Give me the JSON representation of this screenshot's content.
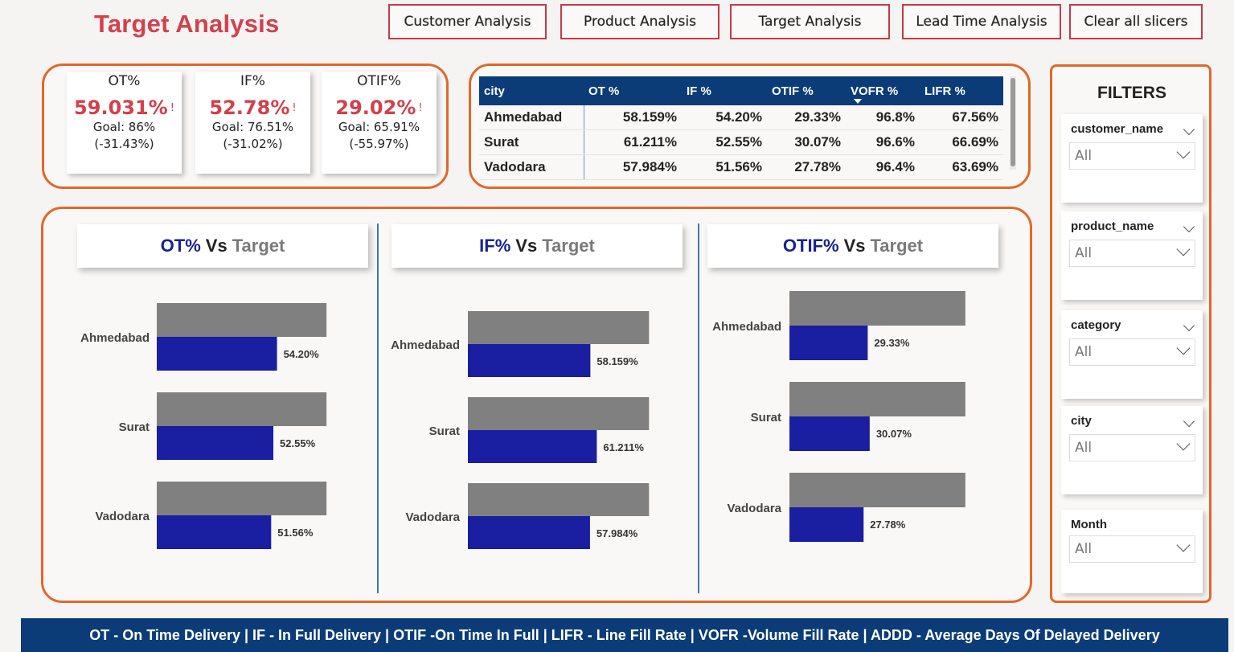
{
  "page_title": "Target Analysis",
  "nav": [
    {
      "label": "Customer Analysis"
    },
    {
      "label": "Product Analysis"
    },
    {
      "label": "Target Analysis"
    },
    {
      "label": "Lead Time Analysis"
    },
    {
      "label": "Clear all slicers"
    }
  ],
  "kpis": [
    {
      "title": "OT%",
      "value": "59.031%",
      "warn": "!",
      "goal": "Goal: 86%",
      "diff": "(-31.43%)"
    },
    {
      "title": "IF%",
      "value": "52.78%",
      "warn": "!",
      "goal": "Goal: 76.51%",
      "diff": "(-31.02%)"
    },
    {
      "title": "OTIF%",
      "value": "29.02%",
      "warn": "!",
      "goal": "Goal: 65.91%",
      "diff": "(-55.97%)"
    }
  ],
  "matrix": {
    "headers": [
      "city",
      "OT %",
      "IF %",
      "OTIF %",
      "VOFR %",
      "LIFR %"
    ],
    "rows": [
      [
        "Ahmedabad",
        "58.159%",
        "54.20%",
        "29.33%",
        "96.8%",
        "67.56%"
      ],
      [
        "Surat",
        "61.211%",
        "52.55%",
        "30.07%",
        "96.6%",
        "66.69%"
      ],
      [
        "Vadodara",
        "57.984%",
        "51.56%",
        "27.78%",
        "96.4%",
        "63.69%"
      ]
    ]
  },
  "colors": {
    "actual": "#1a1ea0",
    "target": "#808080",
    "accent": "#e2672a",
    "title_red": "#d2404c",
    "header_navy": "#0c3c77"
  },
  "chart_data": [
    {
      "type": "bar",
      "title_parts": [
        "OT%",
        "Vs",
        "Target"
      ],
      "categories": [
        "Ahmedabad",
        "Surat",
        "Vadodara"
      ],
      "series": [
        {
          "values": [
            76.51,
            76.51,
            76.51
          ]
        },
        {
          "values": [
            54.2,
            52.55,
            51.56
          ]
        }
      ],
      "labels": [
        "54.20%",
        "52.55%",
        "51.56%"
      ]
    },
    {
      "type": "bar",
      "title_parts": [
        "IF%",
        "Vs",
        "Target"
      ],
      "categories": [
        "Ahmedabad",
        "Surat",
        "Vadodara"
      ],
      "series": [
        {
          "values": [
            86,
            86,
            86
          ]
        },
        {
          "values": [
            58.159,
            61.211,
            57.984
          ]
        }
      ],
      "labels": [
        "58.159%",
        "61.211%",
        "57.984%"
      ]
    },
    {
      "type": "bar",
      "title_parts": [
        "OTIF%",
        "Vs",
        "Target"
      ],
      "categories": [
        "Ahmedabad",
        "Surat",
        "Vadodara"
      ],
      "series": [
        {
          "values": [
            65.91,
            65.91,
            65.91
          ]
        },
        {
          "values": [
            29.33,
            30.07,
            27.78
          ]
        }
      ],
      "labels": [
        "29.33%",
        "30.07%",
        "27.78%"
      ]
    }
  ],
  "filters": {
    "title": "FILTERS",
    "slicers": [
      {
        "label": "customer_name",
        "value": "All",
        "collapsible": true
      },
      {
        "label": "product_name",
        "value": "All",
        "collapsible": true
      },
      {
        "label": "category",
        "value": "All",
        "collapsible": true
      },
      {
        "label": "city",
        "value": "All",
        "collapsible": true
      },
      {
        "label": "Month",
        "value": "All",
        "collapsible": false
      }
    ]
  },
  "footer_text": "OT - On Time Delivery | IF - In Full Delivery | OTIF -On Time In Full | LIFR - Line Fill Rate | VOFR -Volume Fill Rate | ADDD - Average Days Of Delayed Delivery"
}
